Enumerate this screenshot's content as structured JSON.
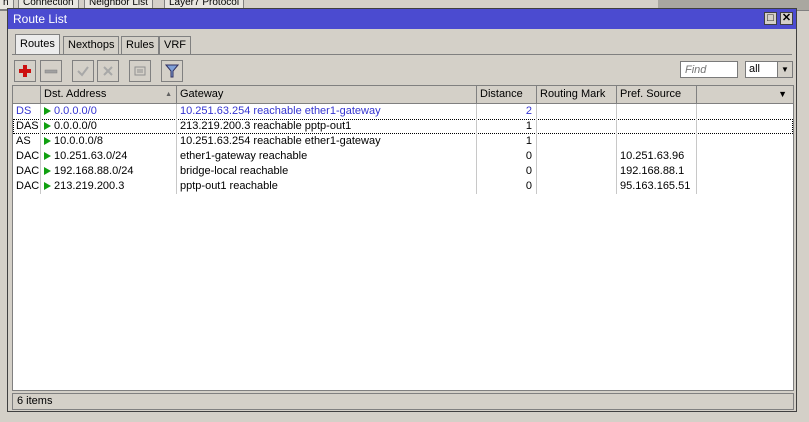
{
  "window": {
    "title": "Route List",
    "minimize_label": "□",
    "close_label": "✕"
  },
  "tabs": [
    {
      "label": "Routes"
    },
    {
      "label": "Nexthops"
    },
    {
      "label": "Rules"
    },
    {
      "label": "VRF"
    }
  ],
  "toolbar": {
    "find_placeholder": "Find",
    "filter_value": "all",
    "filter_arrow": "▼",
    "icons": [
      "add-icon",
      "remove-icon",
      "enable-icon",
      "disable-icon",
      "comment-icon",
      "filter-icon"
    ]
  },
  "table": {
    "columns": [
      {
        "label": ""
      },
      {
        "label": "Dst. Address"
      },
      {
        "label": "Gateway"
      },
      {
        "label": "Distance"
      },
      {
        "label": "Routing Mark"
      },
      {
        "label": "Pref. Source"
      },
      {
        "label": ""
      }
    ],
    "sort_indicator": "▲",
    "menu_arrow": "▼",
    "rows": [
      {
        "flags": "DS",
        "dst": "0.0.0.0/0",
        "gateway": "10.251.63.254 reachable ether1-gateway",
        "distance": "2",
        "routing_mark": "",
        "pref_source": "",
        "color": "#3535d0"
      },
      {
        "flags": "DAS",
        "dst": "0.0.0.0/0",
        "gateway": "213.219.200.3 reachable pptp-out1",
        "distance": "1",
        "routing_mark": "",
        "pref_source": "",
        "color": "#000000"
      },
      {
        "flags": "AS",
        "dst": "10.0.0.0/8",
        "gateway": "10.251.63.254 reachable ether1-gateway",
        "distance": "1",
        "routing_mark": "",
        "pref_source": "",
        "color": "#000000"
      },
      {
        "flags": "DAC",
        "dst": "10.251.63.0/24",
        "gateway": "ether1-gateway reachable",
        "distance": "0",
        "routing_mark": "",
        "pref_source": "10.251.63.96",
        "color": "#000000"
      },
      {
        "flags": "DAC",
        "dst": "192.168.88.0/24",
        "gateway": "bridge-local reachable",
        "distance": "0",
        "routing_mark": "",
        "pref_source": "192.168.88.1",
        "color": "#000000"
      },
      {
        "flags": "DAC",
        "dst": "213.219.200.3",
        "gateway": "pptp-out1 reachable",
        "distance": "0",
        "routing_mark": "",
        "pref_source": "95.163.165.51",
        "color": "#000000"
      }
    ]
  },
  "status": {
    "items_count": "6 items"
  },
  "background": {
    "tabs": [
      "n",
      "Connection",
      "Neighbor List",
      "Layer7 Protocol"
    ]
  },
  "colors": {
    "titlebar": "#4b4bd0",
    "disabled_route_text": "#3535d0",
    "route_flag": "#10a010",
    "add_icon": "#cc1010"
  }
}
